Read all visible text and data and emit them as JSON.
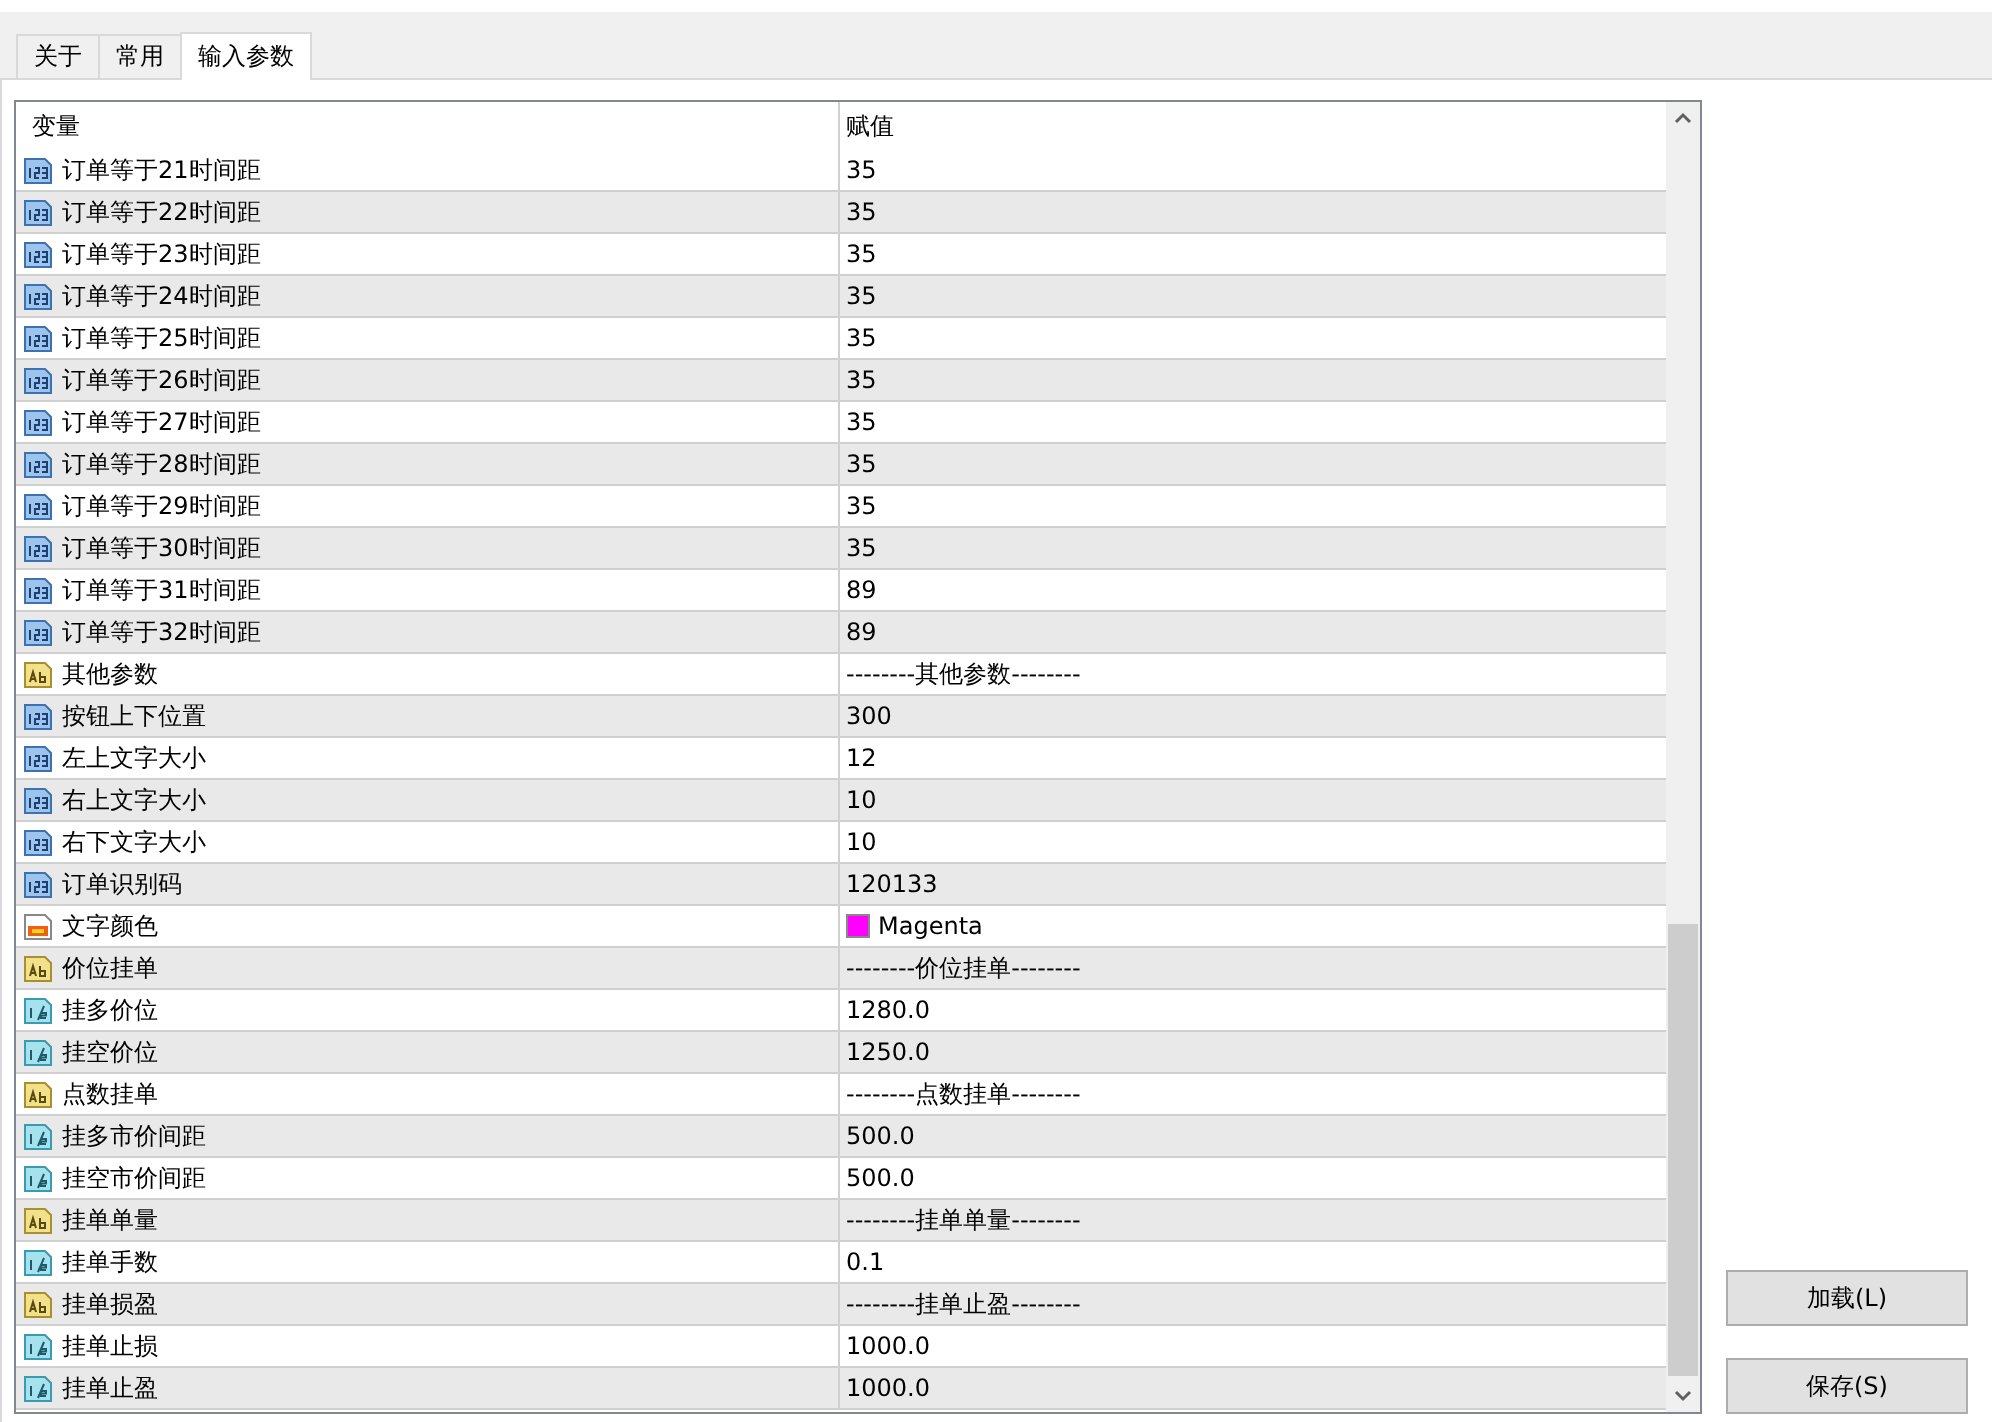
{
  "tabs": [
    {
      "label": "关于",
      "selected": false
    },
    {
      "label": "常用",
      "selected": false
    },
    {
      "label": "输入参数",
      "selected": true
    }
  ],
  "table": {
    "columns": [
      "变量",
      "赋值"
    ],
    "rows": [
      {
        "kind": "int",
        "name": "订单等于21时间距",
        "value": "35"
      },
      {
        "kind": "int",
        "name": "订单等于22时间距",
        "value": "35"
      },
      {
        "kind": "int",
        "name": "订单等于23时间距",
        "value": "35"
      },
      {
        "kind": "int",
        "name": "订单等于24时间距",
        "value": "35"
      },
      {
        "kind": "int",
        "name": "订单等于25时间距",
        "value": "35"
      },
      {
        "kind": "int",
        "name": "订单等于26时间距",
        "value": "35"
      },
      {
        "kind": "int",
        "name": "订单等于27时间距",
        "value": "35"
      },
      {
        "kind": "int",
        "name": "订单等于28时间距",
        "value": "35"
      },
      {
        "kind": "int",
        "name": "订单等于29时间距",
        "value": "35"
      },
      {
        "kind": "int",
        "name": "订单等于30时间距",
        "value": "35"
      },
      {
        "kind": "int",
        "name": "订单等于31时间距",
        "value": "89"
      },
      {
        "kind": "int",
        "name": "订单等于32时间距",
        "value": "89"
      },
      {
        "kind": "string",
        "name": "其他参数",
        "value": "--------其他参数--------"
      },
      {
        "kind": "int",
        "name": "按钮上下位置",
        "value": "300"
      },
      {
        "kind": "int",
        "name": "左上文字大小",
        "value": "12"
      },
      {
        "kind": "int",
        "name": "右上文字大小",
        "value": "10"
      },
      {
        "kind": "int",
        "name": "右下文字大小",
        "value": "10"
      },
      {
        "kind": "int",
        "name": "订单识别码",
        "value": "120133"
      },
      {
        "kind": "color",
        "name": "文字颜色",
        "value": "Magenta",
        "color": "#ff00ff"
      },
      {
        "kind": "string",
        "name": "价位挂单",
        "value": "--------价位挂单--------"
      },
      {
        "kind": "double",
        "name": "挂多价位",
        "value": "1280.0"
      },
      {
        "kind": "double",
        "name": "挂空价位",
        "value": "1250.0"
      },
      {
        "kind": "string",
        "name": "点数挂单",
        "value": "--------点数挂单--------"
      },
      {
        "kind": "double",
        "name": "挂多市价间距",
        "value": "500.0"
      },
      {
        "kind": "double",
        "name": "挂空市价间距",
        "value": "500.0"
      },
      {
        "kind": "string",
        "name": "挂单单量",
        "value": "--------挂单单量--------"
      },
      {
        "kind": "double",
        "name": "挂单手数",
        "value": "0.1"
      },
      {
        "kind": "string",
        "name": "挂单损盈",
        "value": "--------挂单止盈--------"
      },
      {
        "kind": "double",
        "name": "挂单止损",
        "value": "1000.0"
      },
      {
        "kind": "double",
        "name": "挂单止盈",
        "value": "1000.0"
      }
    ]
  },
  "buttons": [
    "加载(L)",
    "保存(S)"
  ]
}
